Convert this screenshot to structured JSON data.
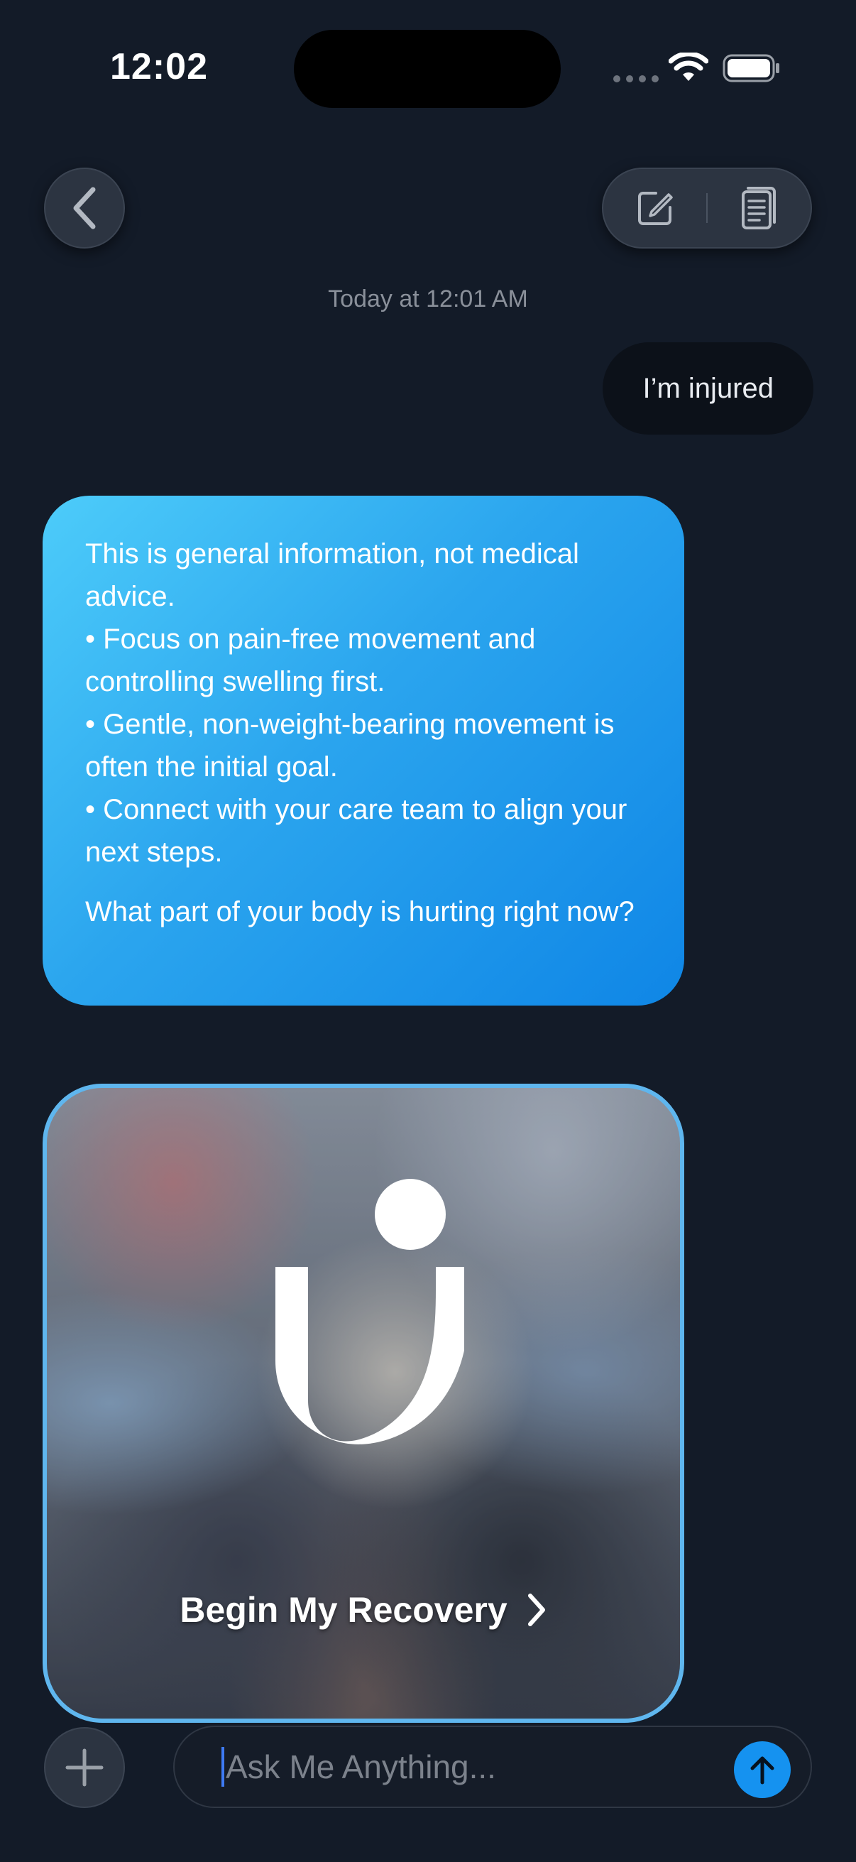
{
  "status_bar": {
    "time": "12:02"
  },
  "nav": {
    "back_icon": "chevron-left-icon",
    "compose_icon": "compose-icon",
    "notes_icon": "document-icon"
  },
  "chat": {
    "timestamp": "Today at 12:01 AM",
    "user_message": "I’m injured",
    "assistant_message": {
      "intro": "This is general information, not medical advice.",
      "bullets": [
        "• Focus on pain-free movement and controlling swelling first.",
        "• Gentle, non-weight-bearing movement is often the initial goal.",
        "• Connect with your care team to align your next steps."
      ],
      "question": "What part of your body is hurting right now?"
    },
    "recovery_card": {
      "cta_label": "Begin My Recovery",
      "cta_icon": "chevron-right-icon",
      "logo_icon": "brand-logo-icon"
    }
  },
  "composer": {
    "placeholder": "Ask Me Anything...",
    "add_icon": "plus-icon",
    "send_icon": "arrow-up-icon"
  },
  "colors": {
    "background": "#131b28",
    "accent": "#1592f0",
    "bubble_gradient_start": "#4dccfa",
    "bubble_gradient_end": "#0f86e6"
  }
}
